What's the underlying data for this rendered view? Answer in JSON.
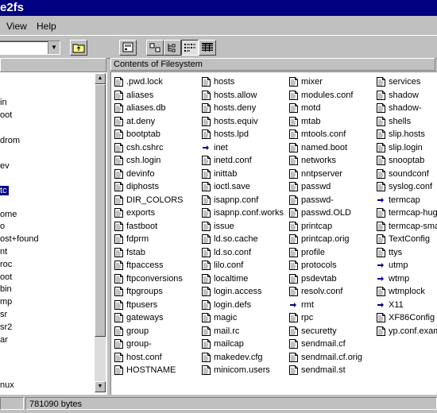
{
  "window": {
    "title": "e2fs"
  },
  "menu": {
    "view": "View",
    "help": "Help"
  },
  "toolbar": {
    "drive_value": "",
    "icons": [
      "up-folder-icon",
      "properties-icon",
      "large-icons-icon",
      "small-icons-icon",
      "list-view-icon",
      "details-view-icon"
    ]
  },
  "left_panel": {
    "header": "",
    "tree": [
      "in",
      "oot",
      "drom",
      "ev",
      "tc",
      "ome",
      "o",
      "ost+found",
      "nt",
      "roc",
      "oot",
      "bin",
      "mp",
      "sr",
      "sr2",
      "ar",
      "nux"
    ],
    "selected": "tc"
  },
  "right_panel": {
    "header": "Contents of Filesystem",
    "columns": [
      [
        {
          "name": ".pwd.lock",
          "icon": "file"
        },
        {
          "name": "aliases",
          "icon": "file"
        },
        {
          "name": "aliases.db",
          "icon": "file"
        },
        {
          "name": "at.deny",
          "icon": "file"
        },
        {
          "name": "bootptab",
          "icon": "file"
        },
        {
          "name": "csh.cshrc",
          "icon": "file"
        },
        {
          "name": "csh.login",
          "icon": "file"
        },
        {
          "name": "devinfo",
          "icon": "file"
        },
        {
          "name": "diphosts",
          "icon": "file"
        },
        {
          "name": "DIR_COLORS",
          "icon": "file"
        },
        {
          "name": "exports",
          "icon": "file"
        },
        {
          "name": "fastboot",
          "icon": "file"
        },
        {
          "name": "fdprm",
          "icon": "file"
        },
        {
          "name": "fstab",
          "icon": "file"
        },
        {
          "name": "ftpaccess",
          "icon": "file"
        },
        {
          "name": "ftpconversions",
          "icon": "file"
        },
        {
          "name": "ftpgroups",
          "icon": "file"
        },
        {
          "name": "ftpusers",
          "icon": "file"
        },
        {
          "name": "gateways",
          "icon": "file"
        },
        {
          "name": "group",
          "icon": "file"
        },
        {
          "name": "group-",
          "icon": "file"
        },
        {
          "name": "host.conf",
          "icon": "file"
        },
        {
          "name": "HOSTNAME",
          "icon": "file"
        }
      ],
      [
        {
          "name": "hosts",
          "icon": "file"
        },
        {
          "name": "hosts.allow",
          "icon": "file"
        },
        {
          "name": "hosts.deny",
          "icon": "file"
        },
        {
          "name": "hosts.equiv",
          "icon": "file"
        },
        {
          "name": "hosts.lpd",
          "icon": "file"
        },
        {
          "name": "inet",
          "icon": "link"
        },
        {
          "name": "inetd.conf",
          "icon": "file"
        },
        {
          "name": "inittab",
          "icon": "file"
        },
        {
          "name": "ioctl.save",
          "icon": "file"
        },
        {
          "name": "isapnp.conf",
          "icon": "file"
        },
        {
          "name": "isapnp.conf.works",
          "icon": "file"
        },
        {
          "name": "issue",
          "icon": "file"
        },
        {
          "name": "ld.so.cache",
          "icon": "file"
        },
        {
          "name": "ld.so.conf",
          "icon": "file"
        },
        {
          "name": "lilo.conf",
          "icon": "file"
        },
        {
          "name": "localtime",
          "icon": "file"
        },
        {
          "name": "login.access",
          "icon": "file"
        },
        {
          "name": "login.defs",
          "icon": "file"
        },
        {
          "name": "magic",
          "icon": "file"
        },
        {
          "name": "mail.rc",
          "icon": "file"
        },
        {
          "name": "mailcap",
          "icon": "file"
        },
        {
          "name": "makedev.cfg",
          "icon": "file"
        },
        {
          "name": "minicom.users",
          "icon": "file"
        }
      ],
      [
        {
          "name": "mixer",
          "icon": "file"
        },
        {
          "name": "modules.conf",
          "icon": "file"
        },
        {
          "name": "motd",
          "icon": "file"
        },
        {
          "name": "mtab",
          "icon": "file"
        },
        {
          "name": "mtools.conf",
          "icon": "file"
        },
        {
          "name": "named.boot",
          "icon": "file"
        },
        {
          "name": "networks",
          "icon": "file"
        },
        {
          "name": "nntpserver",
          "icon": "file"
        },
        {
          "name": "passwd",
          "icon": "file"
        },
        {
          "name": "passwd-",
          "icon": "file"
        },
        {
          "name": "passwd.OLD",
          "icon": "file"
        },
        {
          "name": "printcap",
          "icon": "file"
        },
        {
          "name": "printcap.orig",
          "icon": "file"
        },
        {
          "name": "profile",
          "icon": "file"
        },
        {
          "name": "protocols",
          "icon": "file"
        },
        {
          "name": "psdevtab",
          "icon": "file"
        },
        {
          "name": "resolv.conf",
          "icon": "file"
        },
        {
          "name": "rmt",
          "icon": "link"
        },
        {
          "name": "rpc",
          "icon": "file"
        },
        {
          "name": "securetty",
          "icon": "file"
        },
        {
          "name": "sendmail.cf",
          "icon": "file"
        },
        {
          "name": "sendmail.cf.orig",
          "icon": "file"
        },
        {
          "name": "sendmail.st",
          "icon": "file"
        }
      ],
      [
        {
          "name": "services",
          "icon": "file"
        },
        {
          "name": "shadow",
          "icon": "file"
        },
        {
          "name": "shadow-",
          "icon": "file"
        },
        {
          "name": "shells",
          "icon": "file"
        },
        {
          "name": "slip.hosts",
          "icon": "file"
        },
        {
          "name": "slip.login",
          "icon": "file"
        },
        {
          "name": "snooptab",
          "icon": "file"
        },
        {
          "name": "soundconf",
          "icon": "file"
        },
        {
          "name": "syslog.conf",
          "icon": "file"
        },
        {
          "name": "termcap",
          "icon": "link"
        },
        {
          "name": "termcap-huge",
          "icon": "file"
        },
        {
          "name": "termcap-small",
          "icon": "file"
        },
        {
          "name": "TextConfig",
          "icon": "file"
        },
        {
          "name": "ttys",
          "icon": "file"
        },
        {
          "name": "utmp",
          "icon": "link"
        },
        {
          "name": "wtmp",
          "icon": "link"
        },
        {
          "name": "wtmplock",
          "icon": "file"
        },
        {
          "name": "X11",
          "icon": "link"
        },
        {
          "name": "XF86Config",
          "icon": "file"
        },
        {
          "name": "yp.conf.example",
          "icon": "file"
        }
      ]
    ]
  },
  "status": {
    "left": "",
    "size": "781090 bytes"
  },
  "colors": {
    "titlebar": "#000080",
    "selection": "#000080",
    "face": "#c0c0c0"
  }
}
